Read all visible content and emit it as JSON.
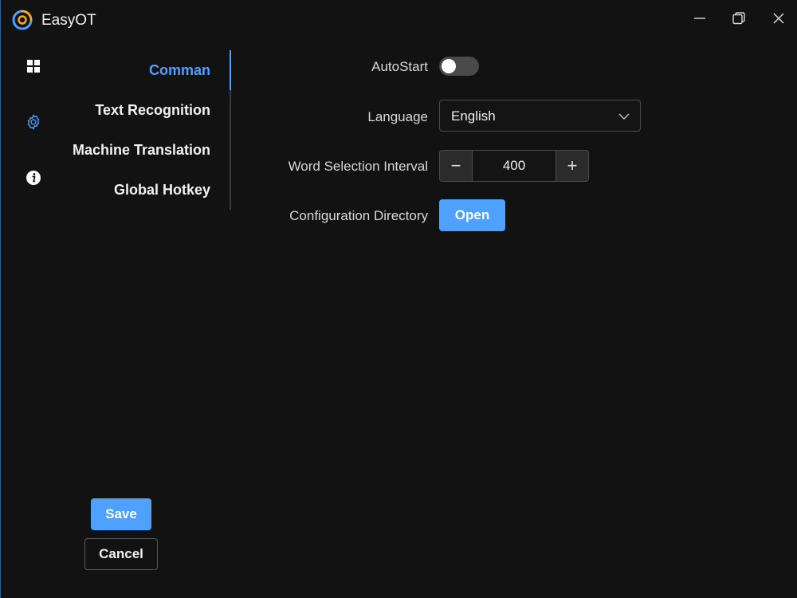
{
  "window": {
    "title": "EasyOT",
    "logo_icon": "easyot-logo",
    "controls": {
      "minimize_icon": "minimize-icon",
      "maximize_icon": "maximize-icon",
      "close_icon": "close-icon"
    }
  },
  "rail": {
    "items": [
      {
        "icon": "apps-grid-icon"
      },
      {
        "icon": "gear-icon",
        "active": true
      },
      {
        "icon": "info-icon"
      }
    ]
  },
  "nav": {
    "items": [
      {
        "label": "Comman",
        "active": true
      },
      {
        "label": "Text Recognition"
      },
      {
        "label": "Machine Translation"
      },
      {
        "label": "Global Hotkey"
      }
    ]
  },
  "settings": {
    "autostart": {
      "label": "AutoStart",
      "enabled": false
    },
    "language": {
      "label": "Language",
      "value": "English"
    },
    "interval": {
      "label": "Word Selection Interval",
      "value": "400",
      "minus": "−",
      "plus": "+"
    },
    "config_dir": {
      "label": "Configuration Directory",
      "button": "Open"
    }
  },
  "footer": {
    "save": "Save",
    "cancel": "Cancel"
  },
  "colors": {
    "accent": "#4ea1ff",
    "background": "#121212",
    "logo_orange": "#f5a623",
    "logo_blue": "#4ea1ff"
  }
}
